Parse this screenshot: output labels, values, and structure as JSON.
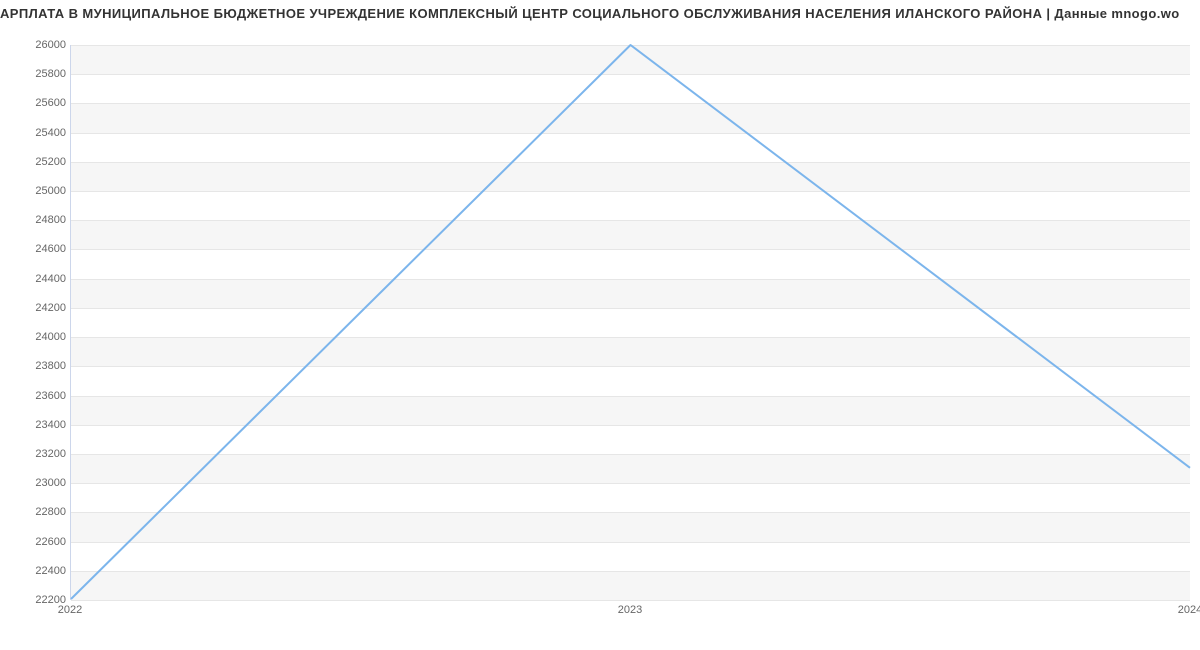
{
  "chart_data": {
    "type": "line",
    "title": "АРПЛАТА В МУНИЦИПАЛЬНОЕ БЮДЖЕТНОЕ УЧРЕЖДЕНИЕ КОМПЛЕКСНЫЙ ЦЕНТР СОЦИАЛЬНОГО ОБСЛУЖИВАНИЯ НАСЕЛЕНИЯ ИЛАНСКОГО РАЙОНА | Данные mnogo.wo",
    "xlabel": "",
    "ylabel": "",
    "x": [
      2022,
      2023,
      2024
    ],
    "values": [
      22200,
      26000,
      23100
    ],
    "xlim": [
      2022,
      2024
    ],
    "ylim": [
      22200,
      26000
    ],
    "yticks": [
      22200,
      22400,
      22600,
      22800,
      23000,
      23200,
      23400,
      23600,
      23800,
      24000,
      24200,
      24400,
      24600,
      24800,
      25000,
      25200,
      25400,
      25600,
      25800,
      26000
    ],
    "xticks": [
      2022,
      2023,
      2024
    ]
  }
}
